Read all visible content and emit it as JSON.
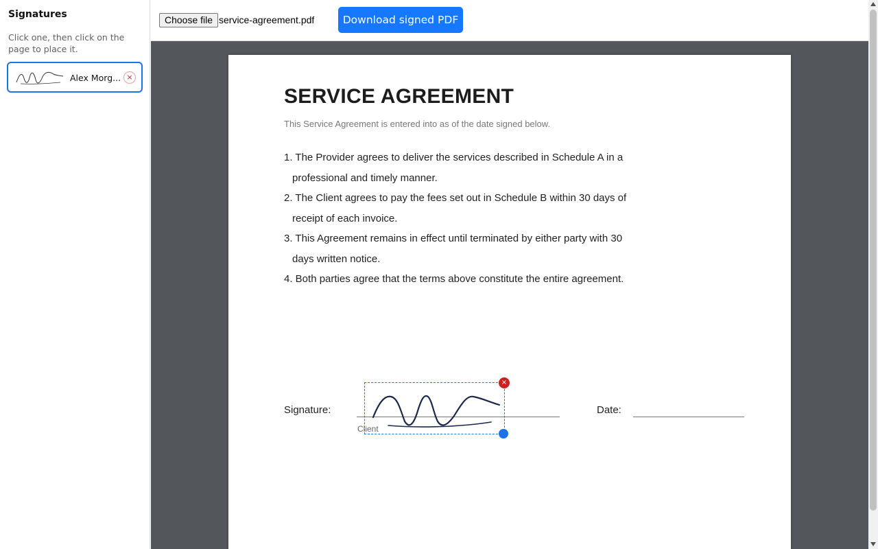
{
  "sidebar": {
    "title": "Signatures",
    "hint": "Click one, then click on the page to place it.",
    "signature_card": {
      "name": "Alex Morg...",
      "remove_glyph": "×",
      "thumb_icon": "signature-thumbnail"
    }
  },
  "toolbar": {
    "choose_file_label": "Choose file",
    "file_name": "service-agreement.pdf",
    "download_label": "Download signed PDF"
  },
  "document": {
    "title": "SERVICE AGREEMENT",
    "subtitle": "This Service Agreement is entered into as of the date signed below.",
    "clauses": [
      {
        "first": "1. The Provider agrees to deliver the services described in Schedule A in a",
        "rest": "professional and timely manner."
      },
      {
        "first": "2. The Client agrees to pay the fees set out in Schedule B within 30 days of",
        "rest": "receipt of each invoice."
      },
      {
        "first": "3. This Agreement remains in effect until terminated by either party with 30",
        "rest": "days written notice."
      },
      {
        "first": "4. Both parties agree that the terms above constitute the entire agreement.",
        "rest": ""
      }
    ],
    "signature_label": "Signature:",
    "client_label": "Client",
    "date_label": "Date:"
  },
  "placed_signature": {
    "delete_glyph": "×",
    "ink_color": "#1b2a4a"
  },
  "colors": {
    "accent": "#1677ff",
    "viewer_background": "#53575b",
    "delete_red": "#cc1f1f"
  }
}
